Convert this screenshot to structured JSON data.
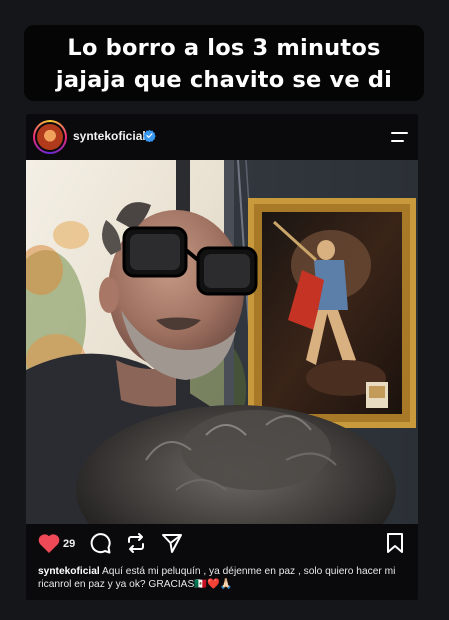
{
  "story_caption": {
    "line1": "Lo borro a los 3 minutos",
    "line2": "jajaja que chavito se ve di"
  },
  "post": {
    "username": "syntekoficial",
    "verified": true,
    "likes": "29",
    "caption_text": "Aquí está mi peluquín , ya déjenme en paz , solo quiero hacer mi ricanrol en paz y ya ok? GRACIAS🇲🇽❤️🙏🏻"
  },
  "colors": {
    "like_heart": "#ed4956",
    "verified_badge": "#3897f0",
    "background": "#14161a"
  },
  "icons": [
    "heart-icon",
    "comment-icon",
    "repost-icon",
    "share-icon",
    "bookmark-icon",
    "menu-icon",
    "verified-icon"
  ]
}
